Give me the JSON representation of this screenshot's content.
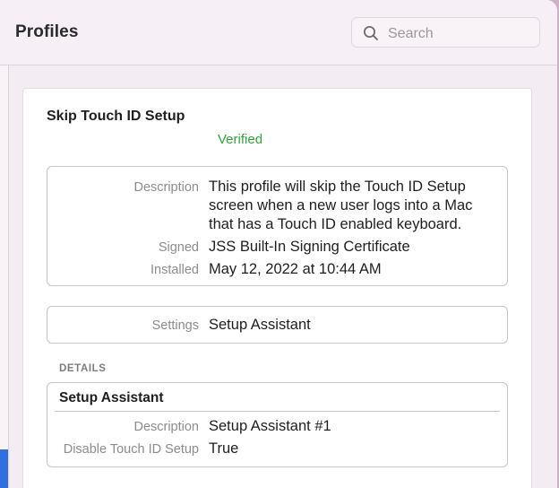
{
  "window": {
    "title": "Profiles"
  },
  "search": {
    "placeholder": "Search",
    "icon": "search-icon"
  },
  "profile": {
    "name": "Skip Touch ID Setup",
    "status": "Verified",
    "status_color": "#30a43a"
  },
  "summary": {
    "description_label": "Description",
    "description_lines": [
      "This profile will skip the Touch ID Setup",
      "screen when a new user logs into a Mac",
      "that has a Touch ID enabled keyboard."
    ],
    "signed_label": "Signed",
    "signed_value": "JSS Built-In Signing Certificate",
    "installed_label": "Installed",
    "installed_value": "May 12, 2022 at 10:44 AM"
  },
  "settings": {
    "label": "Settings",
    "value": "Setup Assistant"
  },
  "details": {
    "header": "DETAILS",
    "title": "Setup Assistant",
    "description_label": "Description",
    "description_value": "Setup Assistant #1",
    "disable_touch_id_label": "Disable Touch ID Setup",
    "disable_touch_id_value": "True"
  },
  "colors": {
    "accent": "#2f6fe0",
    "window_bg": "#f5eef4"
  }
}
